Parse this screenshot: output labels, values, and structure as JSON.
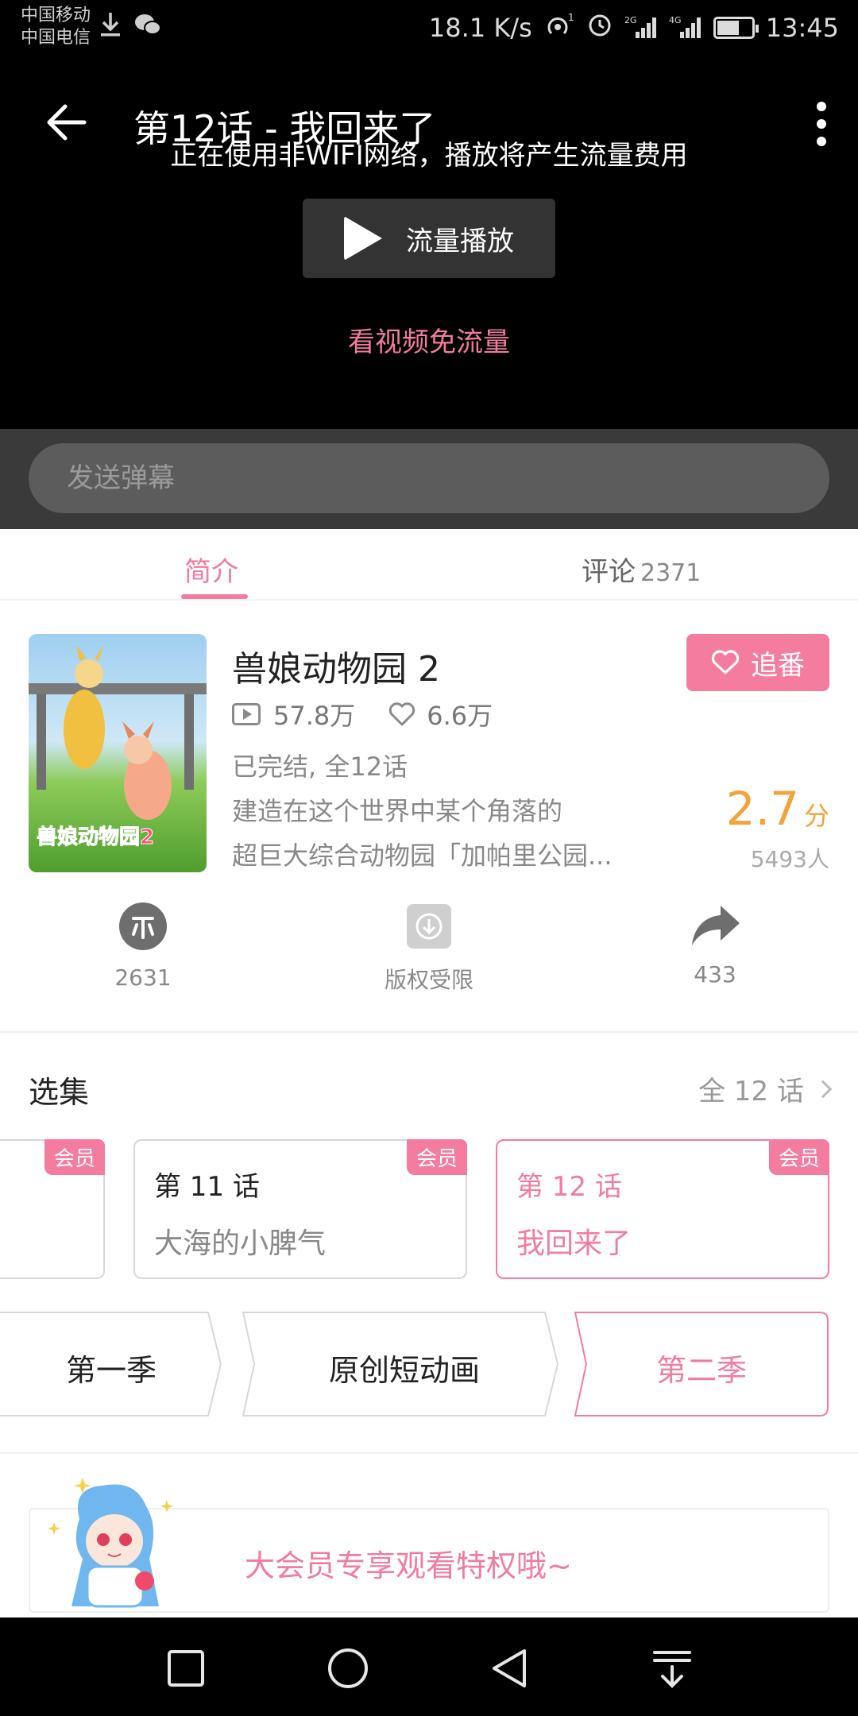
{
  "status_bar": {
    "carrier1": "中国移动",
    "carrier2": "中国电信",
    "speed": "18.1 K/s",
    "time": "13:45",
    "icons": [
      "download-icon",
      "wechat-icon",
      "hotspot-icon",
      "alarm-icon",
      "signal-2g-icon",
      "signal-4g-icon",
      "battery-icon"
    ]
  },
  "player": {
    "title": "第12话 - 我回来了",
    "network_warning": "正在使用非WIFI网络，播放将产生流量费用",
    "play_data_label": "流量播放",
    "free_data_link": "看视频免流量"
  },
  "danmaku": {
    "placeholder": "发送弹幕"
  },
  "tabs": {
    "intro": "简介",
    "comments": "评论",
    "comments_count": "2371"
  },
  "show": {
    "title": "兽娘动物园 2",
    "plays": "57.8万",
    "likes": "6.6万",
    "status": "已完结, 全12话",
    "desc_line1": "建造在这个世界中某个角落的",
    "desc_line2": "超巨大综合动物园「加帕里公园...",
    "follow_label": "追番",
    "score": "2.7",
    "score_unit": "分",
    "raters": "5493人",
    "cover_caption": "兽娘动物园2"
  },
  "actions": {
    "coins": "2631",
    "download": "版权受限",
    "shares": "433"
  },
  "episodes": {
    "section_title": "选集",
    "total": "全 12 话",
    "badge": "会员",
    "items": [
      {
        "no": "第 11 话",
        "name": "大海的小脾气"
      },
      {
        "no": "第 12 话",
        "name": "我回来了"
      }
    ]
  },
  "seasons": {
    "items": [
      "第一季",
      "原创短动画",
      "第二季"
    ]
  },
  "vip": {
    "text": "大会员专享观看特权哦~"
  },
  "colors": {
    "accent": "#f07ca0",
    "follow_bg": "#f47c9f",
    "score": "#f4a23a"
  }
}
